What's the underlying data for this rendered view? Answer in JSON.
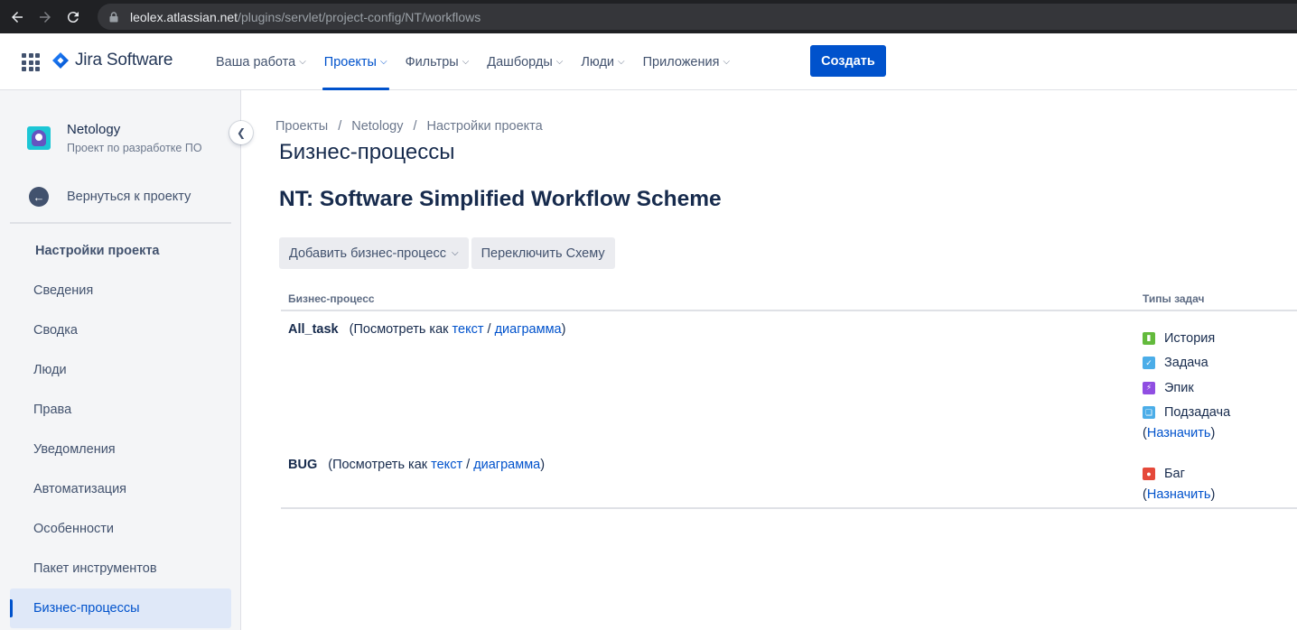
{
  "browser": {
    "url_host": "leolex.atlassian.net",
    "url_path": "/plugins/servlet/project-config/NT/workflows"
  },
  "topnav": {
    "logo_text": "Jira Software",
    "items": [
      {
        "label": "Ваша работа"
      },
      {
        "label": "Проекты"
      },
      {
        "label": "Фильтры"
      },
      {
        "label": "Дашборды"
      },
      {
        "label": "Люди"
      },
      {
        "label": "Приложения"
      }
    ],
    "create_label": "Создать",
    "active_index": 1
  },
  "sidebar": {
    "project_name": "Netology",
    "project_type": "Проект по разработке ПО",
    "back_label": "Вернуться к проекту",
    "heading": "Настройки проекта",
    "items": [
      {
        "label": "Сведения"
      },
      {
        "label": "Сводка"
      },
      {
        "label": "Люди"
      },
      {
        "label": "Права"
      },
      {
        "label": "Уведомления"
      },
      {
        "label": "Автоматизация"
      },
      {
        "label": "Особенности"
      },
      {
        "label": "Пакет инструментов"
      },
      {
        "label": "Бизнес-процессы"
      }
    ],
    "active_index": 8
  },
  "main": {
    "breadcrumb": [
      "Проекты",
      "Netology",
      "Настройки проекта"
    ],
    "breadcrumb_sep": "/",
    "page_title": "Бизнес-процессы",
    "scheme_title": "NT: Software Simplified Workflow Scheme",
    "add_button": "Добавить бизнес-процесс",
    "switch_button": "Переключить Схему",
    "columns": {
      "workflow": "Бизнес-процесс",
      "types": "Типы задач"
    },
    "view_as": "(Посмотреть как",
    "text_link": "текст",
    "slash": "/",
    "diagram_link": "диаграмма",
    "close_paren": ")",
    "assign_open": "(",
    "assign_link": "Назначить",
    "assign_close": ")",
    "workflows": [
      {
        "name": "All_task",
        "types": [
          {
            "label": "История",
            "icon": "story-icon",
            "color": "#63ba3c"
          },
          {
            "label": "Задача",
            "icon": "task-icon",
            "color": "#4bade8"
          },
          {
            "label": "Эпик",
            "icon": "epic-icon",
            "color": "#904ee2"
          },
          {
            "label": "Подзадача",
            "icon": "subtask-icon",
            "color": "#4bade8"
          }
        ]
      },
      {
        "name": "BUG",
        "types": [
          {
            "label": "Баг",
            "icon": "bug-icon",
            "color": "#e5493a"
          }
        ]
      }
    ]
  },
  "colors": {
    "primary": "#0052cc",
    "sidebar_bg": "#f4f5f7",
    "active_item_bg": "#dfe8f8"
  }
}
